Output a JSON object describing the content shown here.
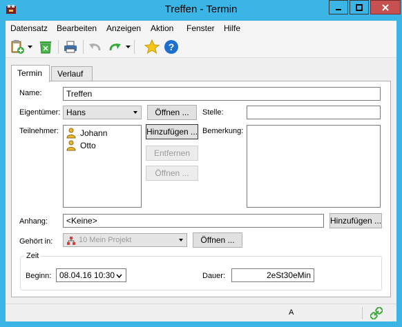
{
  "window": {
    "title": "Treffen - Termin"
  },
  "menu": [
    "Datensatz",
    "Bearbeiten",
    "Anzeigen",
    "Aktion",
    "Fenster",
    "Hilfe"
  ],
  "tabs": [
    "Termin",
    "Verlauf"
  ],
  "form": {
    "name_label": "Name:",
    "name_value": "Treffen",
    "owner_label": "Eigentümer:",
    "owner_value": "Hans",
    "open_label": "Öffnen ...",
    "position_label": "Stelle:",
    "position_value": "",
    "participants_label": "Teilnehmer:",
    "participants": [
      "Johann",
      "Otto"
    ],
    "add_label": "Hinzufügen ...",
    "remove_label": "Entfernen",
    "remark_label": "Bemerkung:",
    "remark_value": "",
    "attachment_label": "Anhang:",
    "attachment_value": "<Keine>",
    "belongs_label": "Gehört in:",
    "belongs_value": "10 Mein Projekt",
    "time_group_label": "Zeit",
    "begin_label": "Beginn:",
    "begin_value": "08.04.16  10:30",
    "duration_label": "Dauer:",
    "duration_value": "2eSt30eMin"
  },
  "toolbar": {
    "icons": [
      "clipboard-add-icon",
      "recycle-bin-icon",
      "printer-icon",
      "undo-icon",
      "redo-icon",
      "star-icon",
      "help-icon"
    ]
  },
  "status": {
    "text": "A"
  },
  "colors": {
    "titlebar": "#3bb4e6",
    "close": "#c75050",
    "star": "#f5c518",
    "help": "#1f6fd1"
  }
}
